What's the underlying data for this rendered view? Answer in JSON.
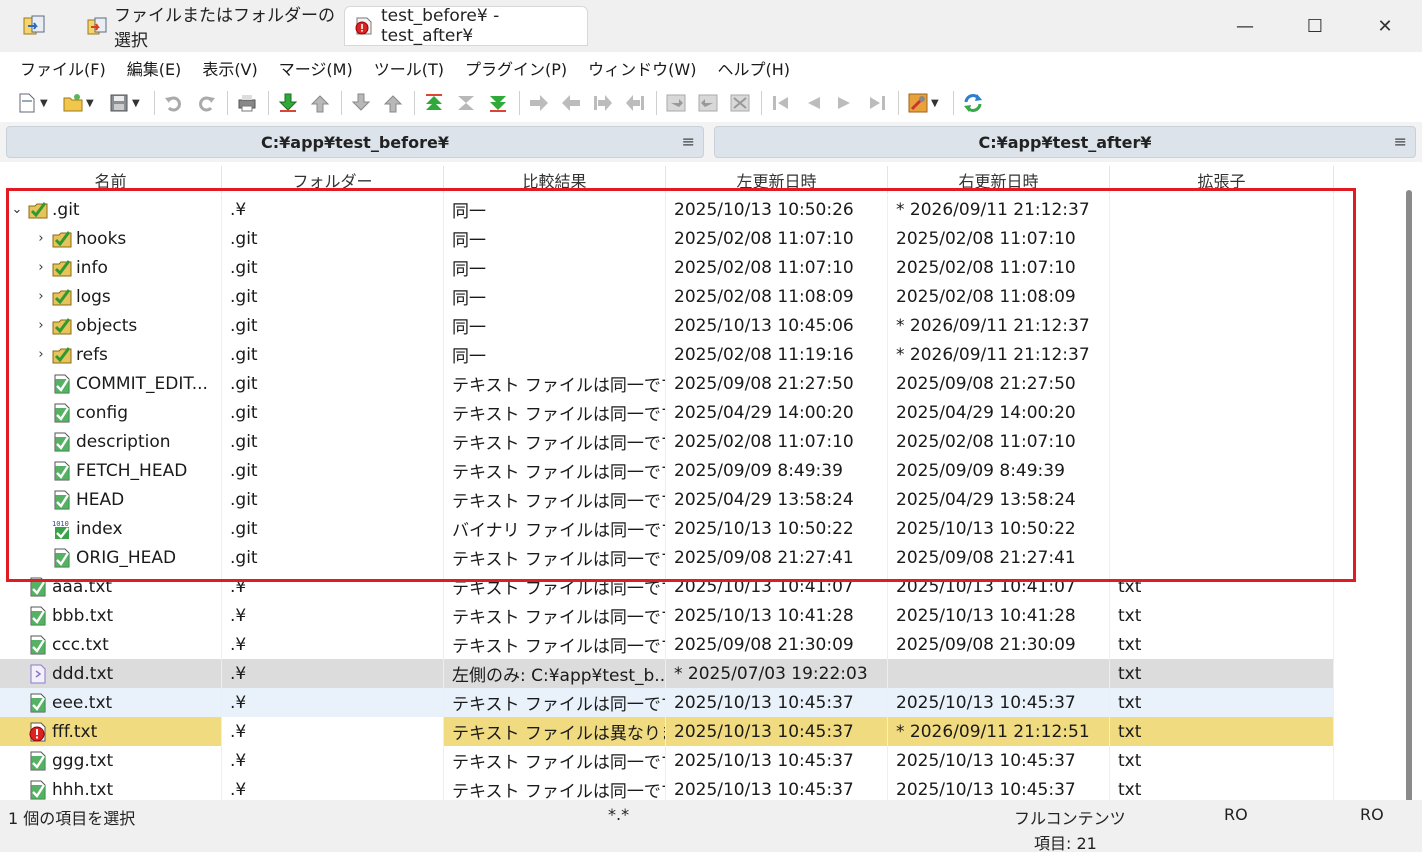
{
  "tabs": {
    "inactive_label": "ファイルまたはフォルダーの選択",
    "active_label": "test_before¥ - test_after¥"
  },
  "window": {
    "minimize": "—",
    "maximize": "☐",
    "close": "✕"
  },
  "menu": [
    "ファイル(F)",
    "編集(E)",
    "表示(V)",
    "マージ(M)",
    "ツール(T)",
    "プラグイン(P)",
    "ウィンドウ(W)",
    "ヘルプ(H)"
  ],
  "paths": {
    "left": "C:¥app¥test_before¥",
    "right": "C:¥app¥test_after¥",
    "menu_glyph": "≡"
  },
  "columns": [
    "名前",
    "フォルダー",
    "比較結果",
    "左更新日時",
    "右更新日時",
    "拡張子"
  ],
  "rows": [
    {
      "expander": "⌄",
      "indent": 0,
      "icon": "folder-same",
      "name": ".git",
      "folder": ".¥",
      "result": "同一",
      "left": "2025/10/13 10:50:26",
      "right": "* 2026/09/11 21:12:37",
      "ext": "",
      "style": ""
    },
    {
      "expander": "›",
      "indent": 1,
      "icon": "folder-same",
      "name": "hooks",
      "folder": ".git",
      "result": "同一",
      "left": "2025/02/08 11:07:10",
      "right": "2025/02/08 11:07:10",
      "ext": "",
      "style": ""
    },
    {
      "expander": "›",
      "indent": 1,
      "icon": "folder-same",
      "name": "info",
      "folder": ".git",
      "result": "同一",
      "left": "2025/02/08 11:07:10",
      "right": "2025/02/08 11:07:10",
      "ext": "",
      "style": ""
    },
    {
      "expander": "›",
      "indent": 1,
      "icon": "folder-same",
      "name": "logs",
      "folder": ".git",
      "result": "同一",
      "left": "2025/02/08 11:08:09",
      "right": "2025/02/08 11:08:09",
      "ext": "",
      "style": ""
    },
    {
      "expander": "›",
      "indent": 1,
      "icon": "folder-same",
      "name": "objects",
      "folder": ".git",
      "result": "同一",
      "left": "2025/10/13 10:45:06",
      "right": "* 2026/09/11 21:12:37",
      "ext": "",
      "style": ""
    },
    {
      "expander": "›",
      "indent": 1,
      "icon": "folder-same",
      "name": "refs",
      "folder": ".git",
      "result": "同一",
      "left": "2025/02/08 11:19:16",
      "right": "* 2026/09/11 21:12:37",
      "ext": "",
      "style": ""
    },
    {
      "expander": "",
      "indent": 1,
      "icon": "file-same",
      "name": "COMMIT_EDIT...",
      "folder": ".git",
      "result": "テキスト ファイルは同一です",
      "left": "2025/09/08 21:27:50",
      "right": "2025/09/08 21:27:50",
      "ext": "",
      "style": ""
    },
    {
      "expander": "",
      "indent": 1,
      "icon": "file-same",
      "name": "config",
      "folder": ".git",
      "result": "テキスト ファイルは同一です",
      "left": "2025/04/29 14:00:20",
      "right": "2025/04/29 14:00:20",
      "ext": "",
      "style": ""
    },
    {
      "expander": "",
      "indent": 1,
      "icon": "file-same",
      "name": "description",
      "folder": ".git",
      "result": "テキスト ファイルは同一です",
      "left": "2025/02/08 11:07:10",
      "right": "2025/02/08 11:07:10",
      "ext": "",
      "style": ""
    },
    {
      "expander": "",
      "indent": 1,
      "icon": "file-same",
      "name": "FETCH_HEAD",
      "folder": ".git",
      "result": "テキスト ファイルは同一です",
      "left": "2025/09/09 8:49:39",
      "right": "2025/09/09 8:49:39",
      "ext": "",
      "style": ""
    },
    {
      "expander": "",
      "indent": 1,
      "icon": "file-same",
      "name": "HEAD",
      "folder": ".git",
      "result": "テキスト ファイルは同一です",
      "left": "2025/04/29 13:58:24",
      "right": "2025/04/29 13:58:24",
      "ext": "",
      "style": ""
    },
    {
      "expander": "",
      "indent": 1,
      "icon": "binary-same",
      "name": "index",
      "folder": ".git",
      "result": "バイナリ ファイルは同一です",
      "left": "2025/10/13 10:50:22",
      "right": "2025/10/13 10:50:22",
      "ext": "",
      "style": ""
    },
    {
      "expander": "",
      "indent": 1,
      "icon": "file-same",
      "name": "ORIG_HEAD",
      "folder": ".git",
      "result": "テキスト ファイルは同一です",
      "left": "2025/09/08 21:27:41",
      "right": "2025/09/08 21:27:41",
      "ext": "",
      "style": ""
    },
    {
      "expander": "",
      "indent": 0,
      "icon": "file-same",
      "name": "aaa.txt",
      "folder": ".¥",
      "result": "テキスト ファイルは同一です",
      "left": "2025/10/13 10:41:07",
      "right": "2025/10/13 10:41:07",
      "ext": "txt",
      "style": ""
    },
    {
      "expander": "",
      "indent": 0,
      "icon": "file-same",
      "name": "bbb.txt",
      "folder": ".¥",
      "result": "テキスト ファイルは同一です",
      "left": "2025/10/13 10:41:28",
      "right": "2025/10/13 10:41:28",
      "ext": "txt",
      "style": ""
    },
    {
      "expander": "",
      "indent": 0,
      "icon": "file-same",
      "name": "ccc.txt",
      "folder": ".¥",
      "result": "テキスト ファイルは同一です",
      "left": "2025/09/08 21:30:09",
      "right": "2025/09/08 21:30:09",
      "ext": "txt",
      "style": ""
    },
    {
      "expander": "",
      "indent": 0,
      "icon": "file-left",
      "name": "ddd.txt",
      "folder": ".¥",
      "result": "左側のみ: C:¥app¥test_b...",
      "left": "* 2025/07/03 19:22:03",
      "right": "",
      "ext": "txt",
      "style": "gray"
    },
    {
      "expander": "",
      "indent": 0,
      "icon": "file-same",
      "name": "eee.txt",
      "folder": ".¥",
      "result": "テキスト ファイルは同一です",
      "left": "2025/10/13 10:45:37",
      "right": "2025/10/13 10:45:37",
      "ext": "txt",
      "style": "sel"
    },
    {
      "expander": "",
      "indent": 0,
      "icon": "file-diff",
      "name": "fff.txt",
      "folder": ".¥",
      "result": "テキスト ファイルは異なります",
      "left": "2025/10/13 10:45:37",
      "right": "* 2026/09/11 21:12:51",
      "ext": "txt",
      "style": "diff"
    },
    {
      "expander": "",
      "indent": 0,
      "icon": "file-same",
      "name": "ggg.txt",
      "folder": ".¥",
      "result": "テキスト ファイルは同一です",
      "left": "2025/10/13 10:45:37",
      "right": "2025/10/13 10:45:37",
      "ext": "txt",
      "style": ""
    },
    {
      "expander": "",
      "indent": 0,
      "icon": "file-same",
      "name": "hhh.txt",
      "folder": ".¥",
      "result": "テキスト ファイルは同一です",
      "left": "2025/10/13 10:45:37",
      "right": "2025/10/13 10:45:37",
      "ext": "txt",
      "style": ""
    }
  ],
  "status": {
    "selection": "1 個の項目を選択",
    "filter": "*.*",
    "compare_method": "フルコンテンツ",
    "item_count": "項目: 21",
    "left_ro": "RO",
    "right_ro": "RO"
  },
  "colors": {
    "accent_highlight": "#e01b24",
    "diff_row": "#f1db80",
    "selected_row": "#e9f2fb",
    "left_only_row": "#dcdcdc"
  }
}
